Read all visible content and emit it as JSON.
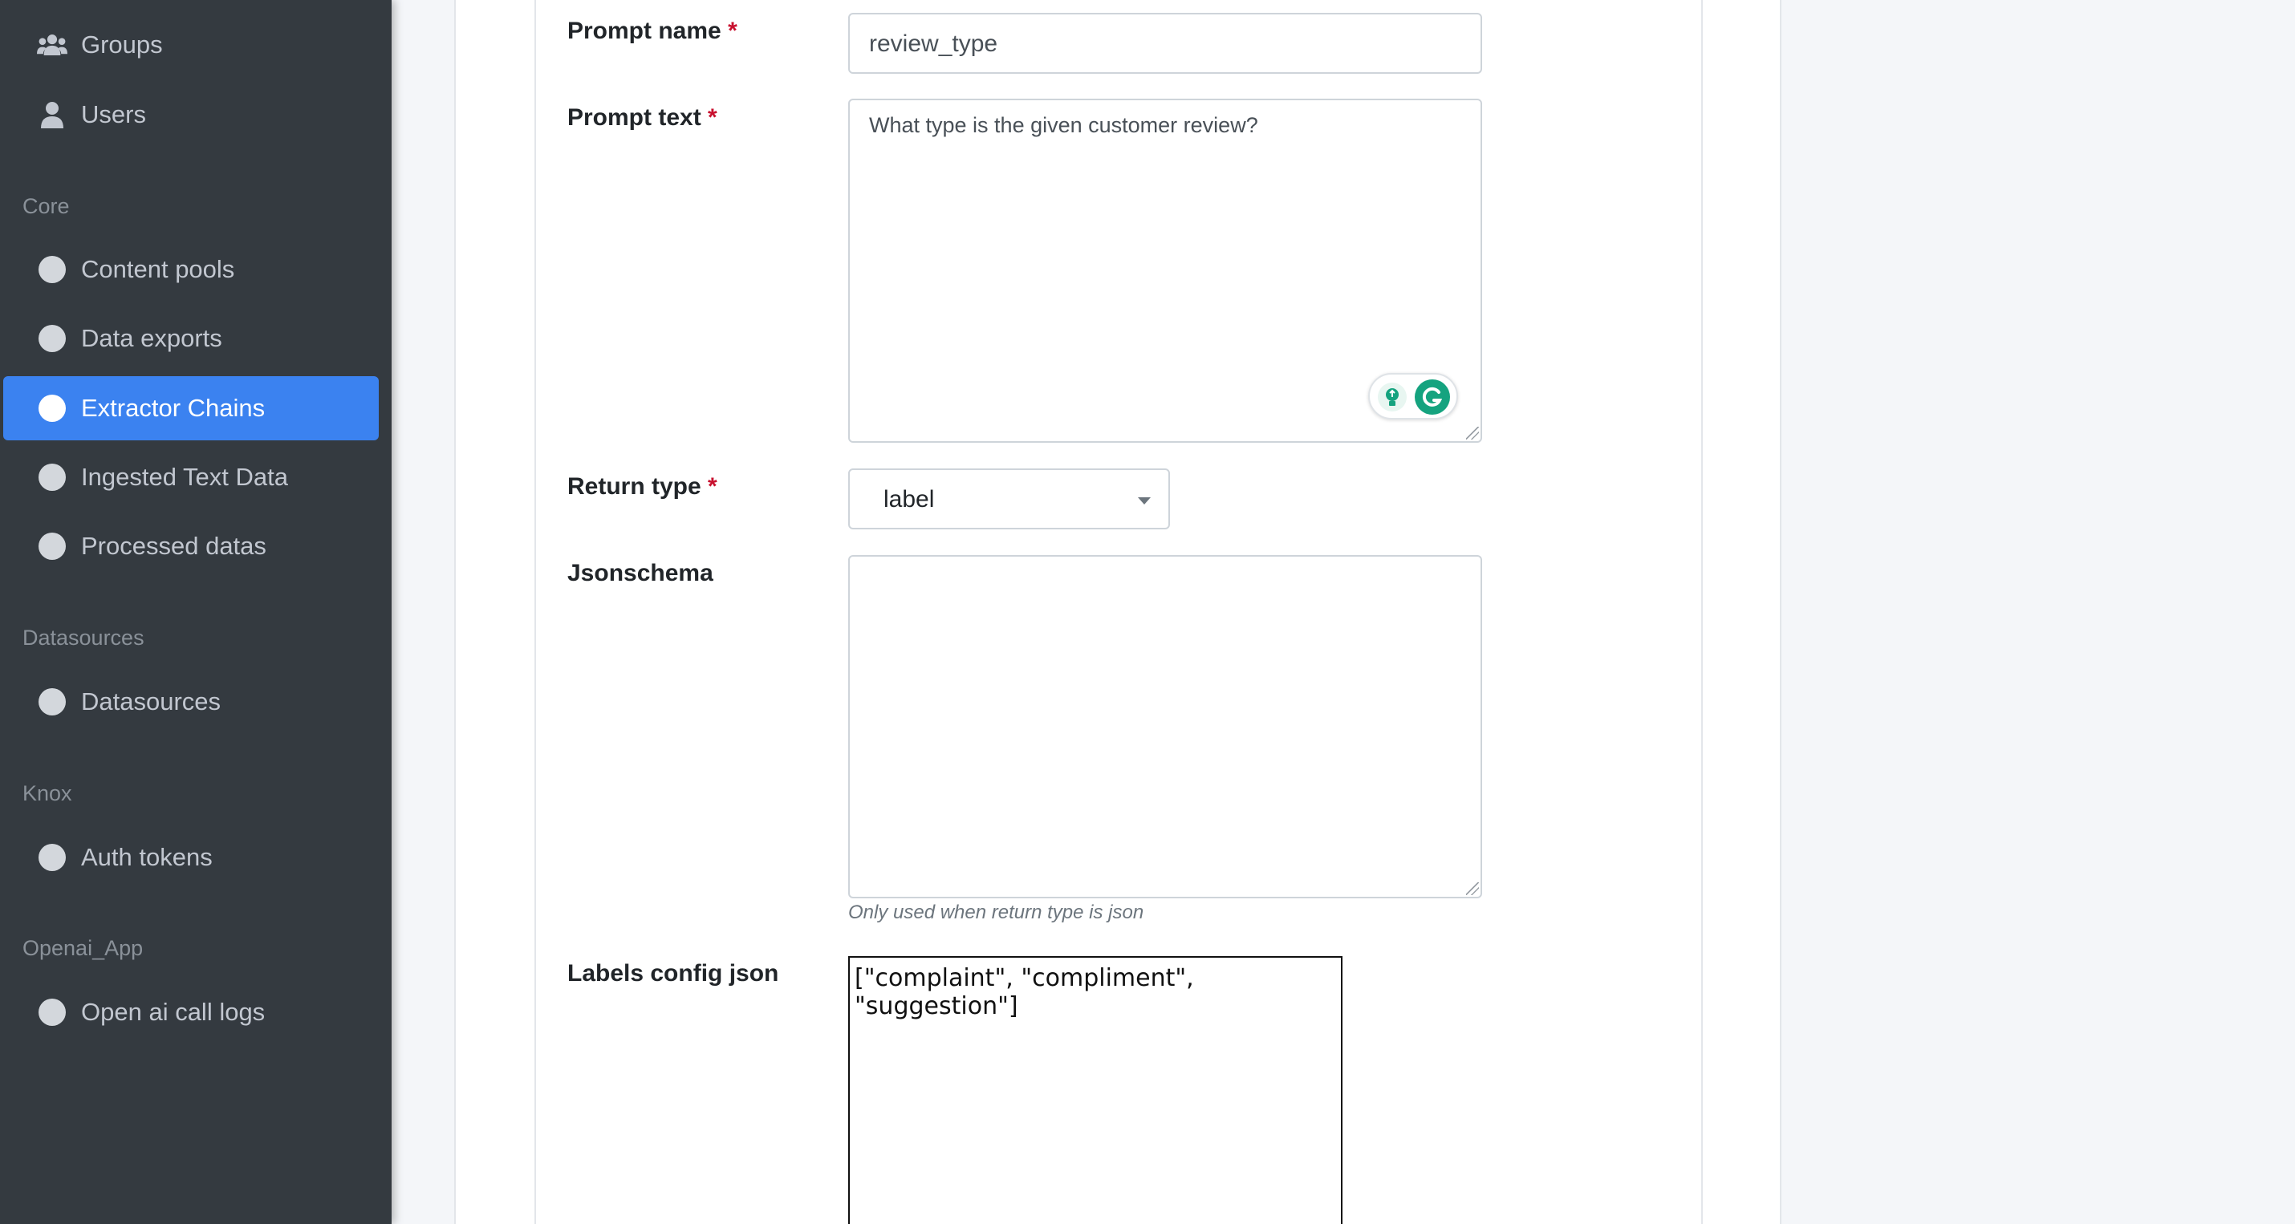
{
  "sidebar": {
    "items_top": [
      {
        "label": "Groups",
        "icon": "users-group-icon"
      },
      {
        "label": "Users",
        "icon": "user-icon"
      }
    ],
    "sections": [
      {
        "header": "Core",
        "items": [
          {
            "label": "Content pools",
            "active": false
          },
          {
            "label": "Data exports",
            "active": false
          },
          {
            "label": "Extractor Chains",
            "active": true
          },
          {
            "label": "Ingested Text Data",
            "active": false
          },
          {
            "label": "Processed datas",
            "active": false
          }
        ]
      },
      {
        "header": "Datasources",
        "items": [
          {
            "label": "Datasources",
            "active": false
          }
        ]
      },
      {
        "header": "Knox",
        "items": [
          {
            "label": "Auth tokens",
            "active": false
          }
        ]
      },
      {
        "header": "Openai_App",
        "items": [
          {
            "label": "Open ai call logs",
            "active": false
          }
        ]
      }
    ],
    "colors": {
      "background": "#343a40",
      "active": "#3b82f0",
      "text": "#c2c7d0"
    }
  },
  "form": {
    "required_marker": "*",
    "prompt_name": {
      "label": "Prompt name",
      "value": "review_type"
    },
    "prompt_text": {
      "label": "Prompt text",
      "value": "What type is the given customer review?"
    },
    "return_type": {
      "label": "Return type",
      "value": "label"
    },
    "jsonschema": {
      "label": "Jsonschema",
      "value": "",
      "help": "Only used when return type is json"
    },
    "labels_config_json": {
      "label": "Labels config json",
      "value": "[\"complaint\", \"compliment\", \"suggestion\"]"
    }
  },
  "extensions": {
    "grammarly": {
      "icons": [
        "lightbulb-icon",
        "grammarly-icon"
      ],
      "color": "#15a37f"
    }
  }
}
